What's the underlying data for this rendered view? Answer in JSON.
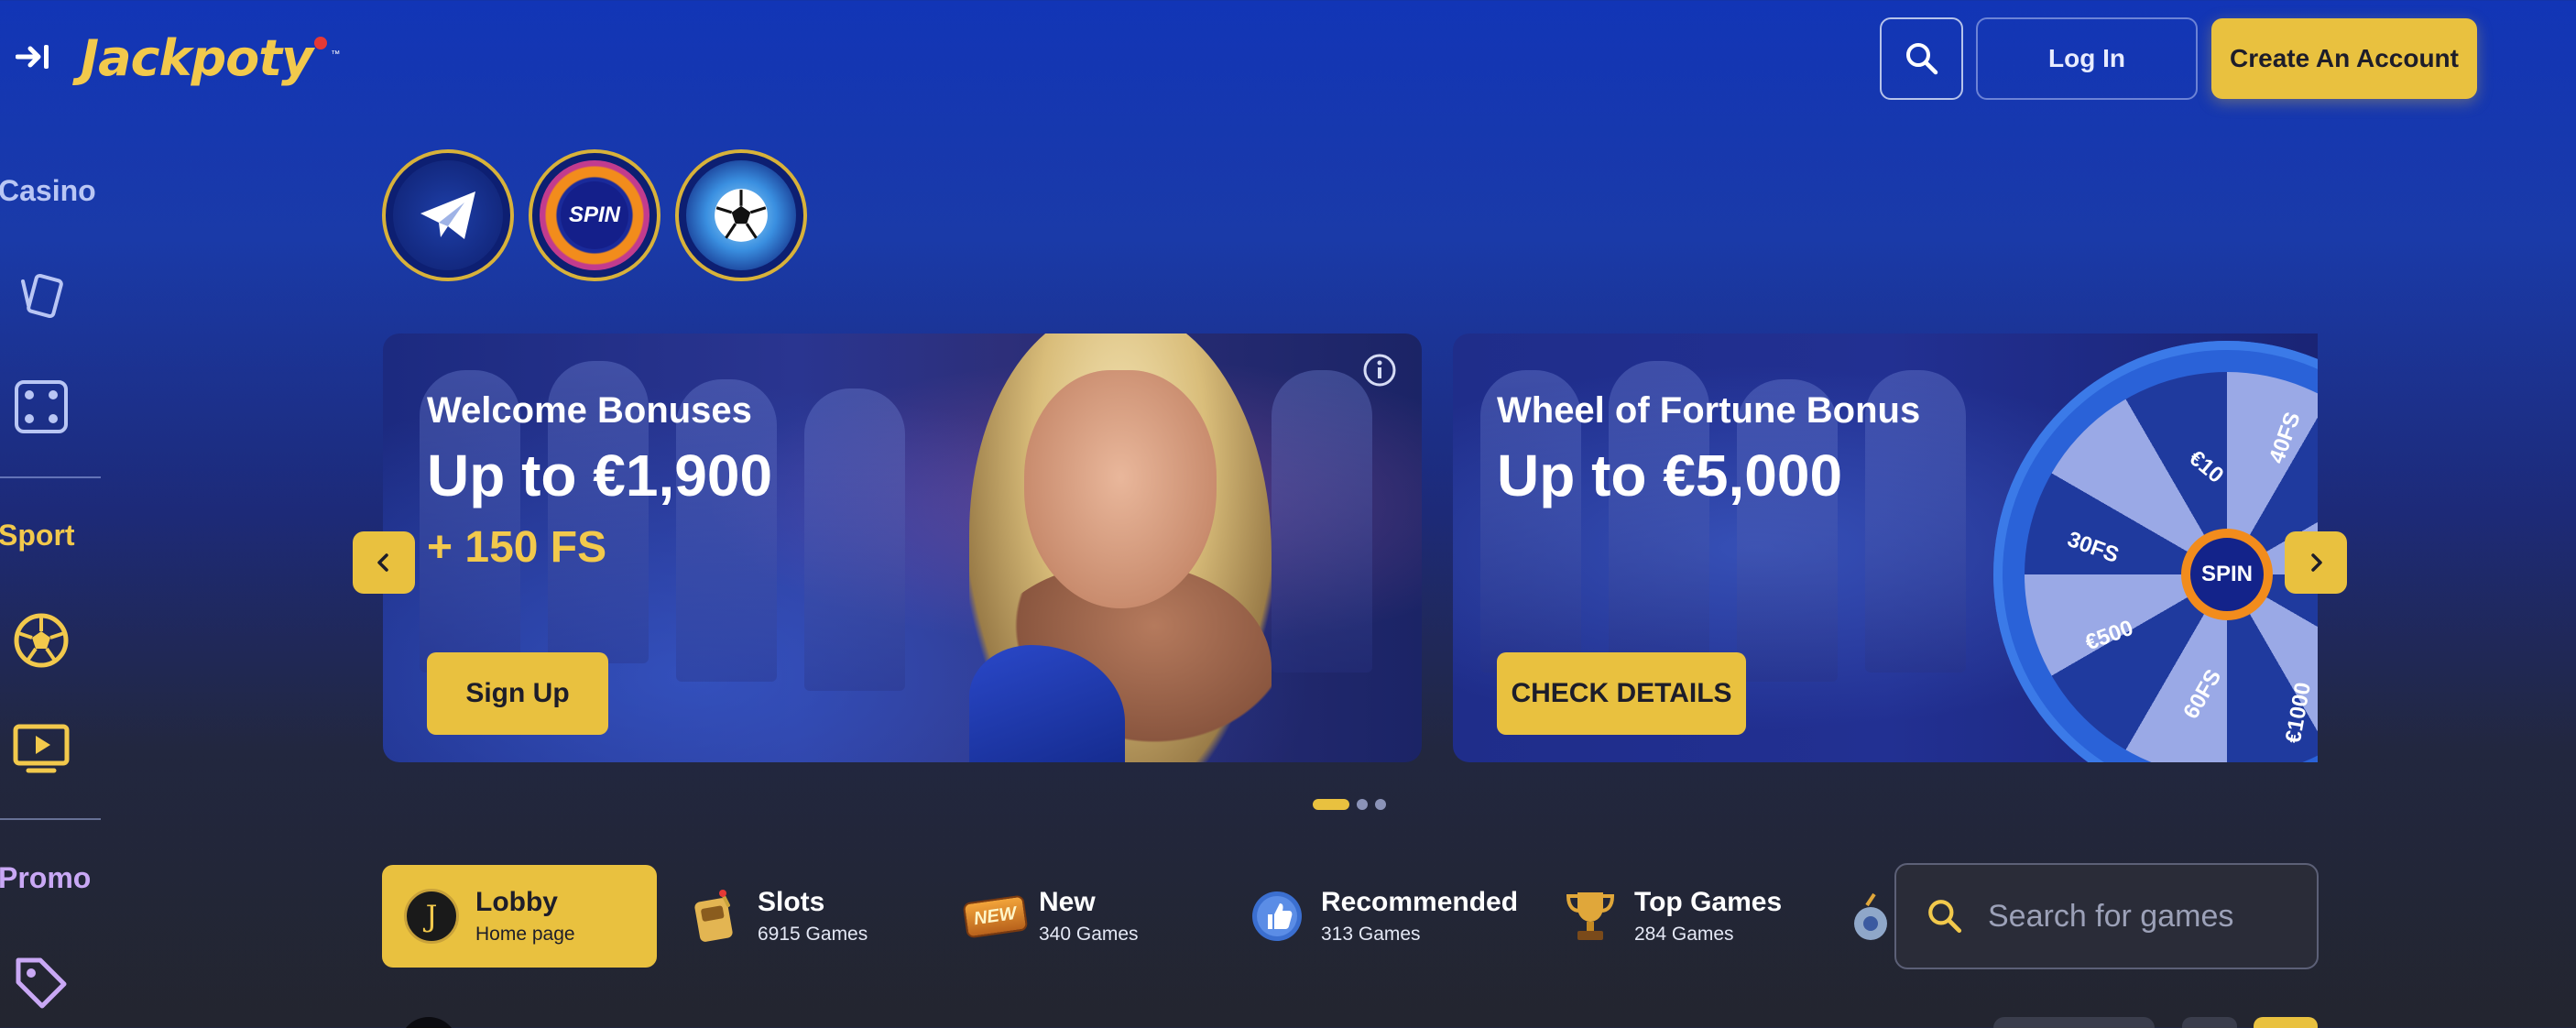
{
  "header": {
    "logo_text": "Jackpoty",
    "logo_tm": "™",
    "login_label": "Log In",
    "create_account_label": "Create An Account",
    "icons": {
      "collapse": "sidebar-expand-icon",
      "search": "search-icon"
    }
  },
  "sidebar": {
    "casino_label": "Casino",
    "sport_label": "Sport",
    "promo_label": "Promo",
    "casino_icons": [
      "cards-icon",
      "dice-icon"
    ],
    "sport_icons": [
      "football-icon",
      "live-tv-icon"
    ],
    "promo_icons": [
      "tag-icon"
    ]
  },
  "stories": [
    {
      "icon": "telegram-icon"
    },
    {
      "icon": "spin-icon",
      "label": "SPIN"
    },
    {
      "icon": "soccer-ball-icon"
    }
  ],
  "banners": [
    {
      "subtitle": "Welcome Bonuses",
      "title": "Up to €1,900",
      "extra": "+ 150 FS",
      "cta": "Sign Up"
    },
    {
      "subtitle": "Wheel of Fortune Bonus",
      "title": "Up to €5,000",
      "cta": "CHECK DETAILS",
      "wheel_hub": "SPIN",
      "wheel_labels": [
        "€10",
        "40FS",
        "30FS",
        "€500",
        "60FS",
        "€1000"
      ]
    }
  ],
  "carousel": {
    "total_slides": 3,
    "active_slide": 1
  },
  "categories": [
    {
      "title": "Lobby",
      "sub": "Home page",
      "icon": "lobby-j-icon",
      "active": true
    },
    {
      "title": "Slots",
      "sub": "6915 Games",
      "icon": "slots-icon"
    },
    {
      "title": "New",
      "sub": "340 Games",
      "icon": "new-badge-icon",
      "icon_text": "NEW"
    },
    {
      "title": "Recommended",
      "sub": "313 Games",
      "icon": "thumbs-up-icon"
    },
    {
      "title": "Top Games",
      "sub": "284 Games",
      "icon": "trophy-icon"
    }
  ],
  "search_games": {
    "placeholder": "Search for games"
  },
  "colors": {
    "accent": "#e9c13f",
    "header_bg": "#1235b6",
    "page_bg": "#23252f",
    "promo": "#c9a8f5"
  }
}
